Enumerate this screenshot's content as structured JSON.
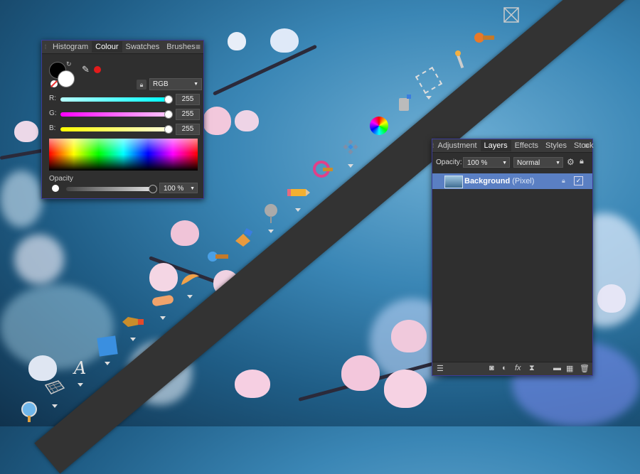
{
  "colour_panel": {
    "tabs": [
      "Histogram",
      "Colour",
      "Swatches",
      "Brushes"
    ],
    "active_tab": "Colour",
    "color_mode": "RGB",
    "sliders": [
      {
        "label": "R:",
        "value": "255",
        "color": "#00ffff"
      },
      {
        "label": "G:",
        "value": "255",
        "color": "#ff00ff"
      },
      {
        "label": "B:",
        "value": "255",
        "color": "#ffff00"
      }
    ],
    "opacity_label": "Opacity",
    "opacity_value": "100 %",
    "accent_red": "#e31b1b"
  },
  "layers_panel": {
    "tabs": [
      "Adjustment",
      "Layers",
      "Effects",
      "Styles",
      "Stock"
    ],
    "active_tab": "Layers",
    "opacity_label": "Opacity:",
    "opacity_value": "100 %",
    "blend_mode": "Normal",
    "layers": [
      {
        "name": "Background",
        "type": "(Pixel)",
        "visible": true
      }
    ],
    "selection_color": "#5a7fc3"
  },
  "toolbar": {
    "tools": [
      "view-tool",
      "crop-tool",
      "artistic-text-tool",
      "rectangle-tool",
      "pen-tool",
      "healing-brush-tool",
      "smudge-tool",
      "clone-brush-tool",
      "fill-tool",
      "dodge-tool",
      "pencil-tool",
      "color-replacement-tool",
      "mesh-warp-tool",
      "color-wheel-tool",
      "paint-bucket-tool",
      "marquee-tool",
      "flood-select-tool",
      "selection-brush-tool",
      "transform-tool"
    ]
  }
}
